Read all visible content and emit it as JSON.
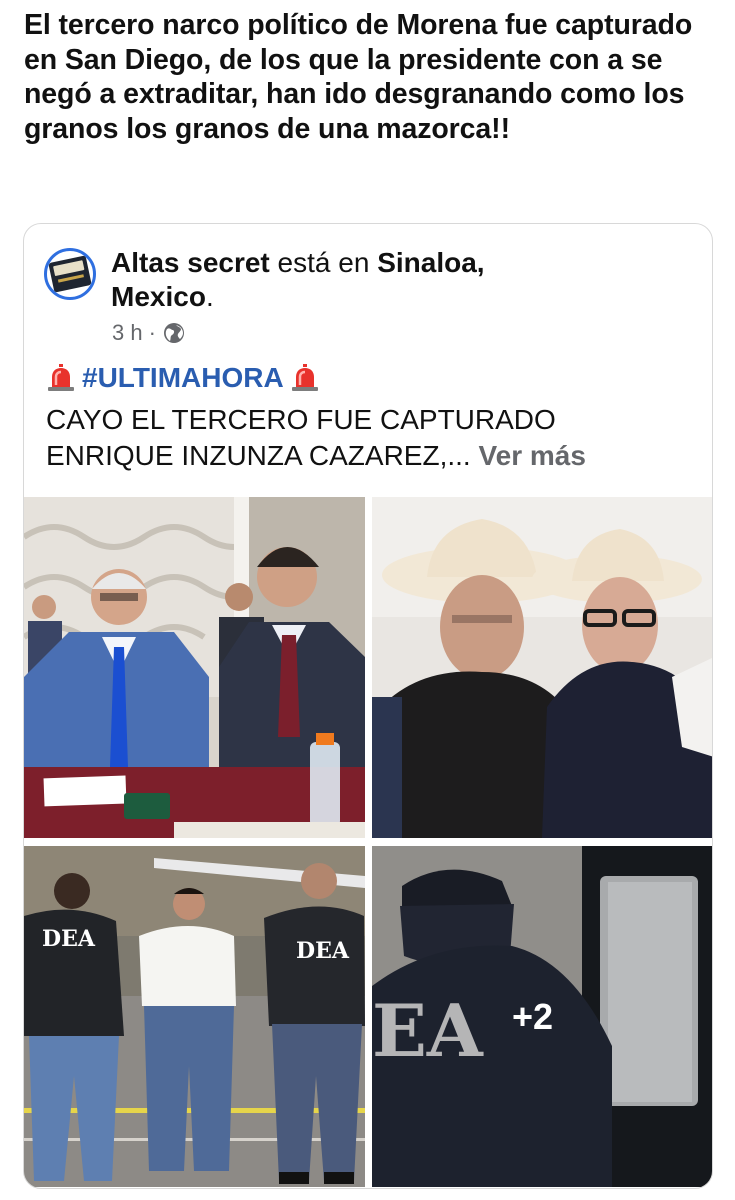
{
  "post": {
    "text": "El tercero narco político de Morena fue capturado en San Diego, de los que la presidente con a se negó a extraditar, han ido desgranando como los granos los granos de una mazorca!!"
  },
  "shared": {
    "author": "Altas secret",
    "verb": "está en",
    "location_line1": "Sinaloa,",
    "location_line2": "Mexico",
    "period": ".",
    "time": "3 h",
    "dot": "·",
    "hashtag": "#ULTIMAHORA",
    "body_line1": "CAYO EL TERCERO FUE CAPTURADO",
    "body_line2": "ENRIQUE INZUNZA CAZAREZ,... ",
    "see_more": "Ver más"
  },
  "photos": {
    "dea_text": "DEA",
    "big_dea_text": "EA",
    "more_count": "+2"
  },
  "colors": {
    "hashtag": "#2a5db0",
    "avatar_ring": "#2f6fe0",
    "meta_gray": "#65676b"
  }
}
